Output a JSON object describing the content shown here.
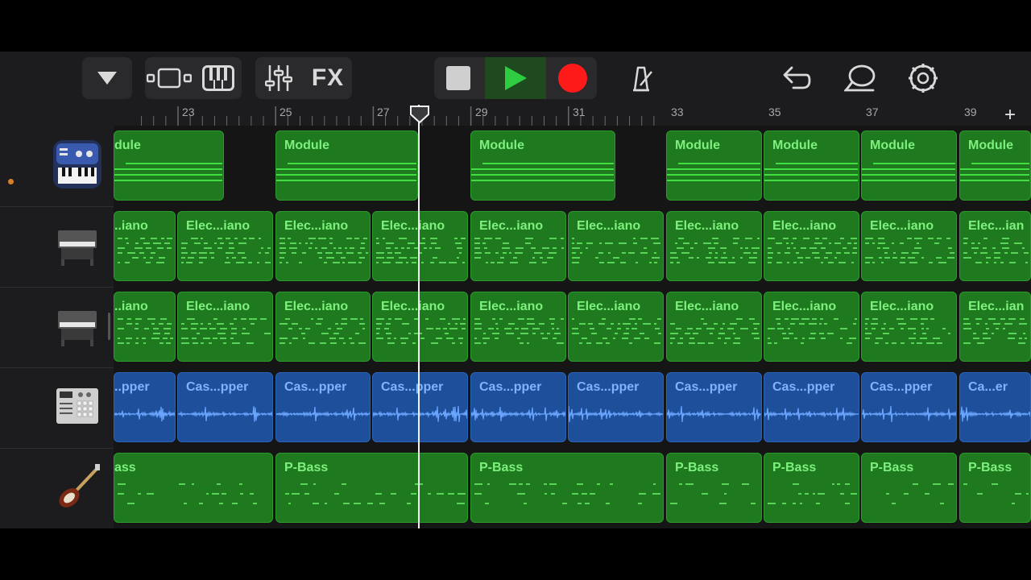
{
  "toolbar": {
    "buttons": [
      {
        "name": "browser-dropdown-button",
        "icon": "triangle-down-icon"
      },
      {
        "name": "tracks-view-button",
        "icon": "tracks-view-icon"
      },
      {
        "name": "keyboard-button",
        "icon": "piano-keys-icon"
      },
      {
        "name": "mixer-button",
        "icon": "sliders-icon"
      },
      {
        "name": "fx-button",
        "label": "FX"
      },
      {
        "name": "stop-button",
        "icon": "stop-icon"
      },
      {
        "name": "play-button",
        "icon": "play-icon"
      },
      {
        "name": "record-button",
        "icon": "record-icon"
      },
      {
        "name": "metronome-button",
        "icon": "metronome-icon"
      },
      {
        "name": "undo-button",
        "icon": "undo-arrow-icon"
      },
      {
        "name": "loop-browser-button",
        "icon": "lasso-loop-icon"
      },
      {
        "name": "settings-button",
        "icon": "gear-icon"
      }
    ],
    "fx_label": "FX",
    "colors": {
      "play": "#2ecc40",
      "record": "#ff1a1a"
    }
  },
  "ruler": {
    "bar_numbers": [
      "23",
      "25",
      "27",
      "29",
      "31",
      "33",
      "35",
      "37",
      "39"
    ],
    "add_label": "+"
  },
  "tracks": [
    {
      "instrument": "synth-module-icon",
      "type": "midi",
      "regions": [
        {
          "name": "dule"
        },
        {
          "name": "Module"
        },
        {
          "name": "Module"
        },
        {
          "name": "Module"
        },
        {
          "name": "Module"
        },
        {
          "name": "Module"
        },
        {
          "name": "Module"
        }
      ]
    },
    {
      "instrument": "electric-piano-icon",
      "type": "midi",
      "regions": [
        {
          "name": "..iano"
        },
        {
          "name": "Elec...iano"
        },
        {
          "name": "Elec...iano"
        },
        {
          "name": "Elec...iano"
        },
        {
          "name": "Elec...iano"
        },
        {
          "name": "Elec...iano"
        },
        {
          "name": "Elec...iano"
        },
        {
          "name": "Elec...iano"
        },
        {
          "name": "Elec...iano"
        },
        {
          "name": "Elec...ian"
        }
      ]
    },
    {
      "instrument": "electric-piano-icon",
      "type": "midi",
      "regions": [
        {
          "name": "..iano"
        },
        {
          "name": "Elec...iano"
        },
        {
          "name": "Elec...iano"
        },
        {
          "name": "Elec...iano"
        },
        {
          "name": "Elec...iano"
        },
        {
          "name": "Elec...iano"
        },
        {
          "name": "Elec...iano"
        },
        {
          "name": "Elec...iano"
        },
        {
          "name": "Elec...iano"
        },
        {
          "name": "Elec...ian"
        }
      ]
    },
    {
      "instrument": "drum-machine-icon",
      "type": "audio",
      "regions": [
        {
          "name": "..pper"
        },
        {
          "name": "Cas...pper"
        },
        {
          "name": "Cas...pper"
        },
        {
          "name": "Cas...pper"
        },
        {
          "name": "Cas...pper"
        },
        {
          "name": "Cas...pper"
        },
        {
          "name": "Cas...pper"
        },
        {
          "name": "Cas...pper"
        },
        {
          "name": "Cas...pper"
        },
        {
          "name": "Ca...er"
        }
      ]
    },
    {
      "instrument": "bass-guitar-icon",
      "type": "midi",
      "regions": [
        {
          "name": "ass"
        },
        {
          "name": "P-Bass"
        },
        {
          "name": "P-Bass"
        },
        {
          "name": "P-Bass"
        },
        {
          "name": "P-Bass"
        },
        {
          "name": "P-Bass"
        },
        {
          "name": "P-Bass"
        }
      ]
    }
  ]
}
